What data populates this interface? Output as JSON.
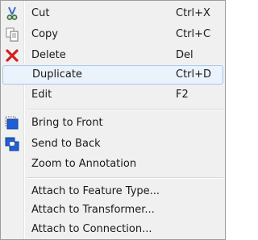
{
  "menu": {
    "items": [
      {
        "label": "Cut",
        "shortcut": "Ctrl+X",
        "icon": "scissors-icon"
      },
      {
        "label": "Copy",
        "shortcut": "Ctrl+C",
        "icon": "copy-icon"
      },
      {
        "label": "Delete",
        "shortcut": "Del",
        "icon": "delete-x-icon"
      },
      {
        "label": "Duplicate",
        "shortcut": "Ctrl+D"
      },
      {
        "label": "Edit",
        "shortcut": "F2"
      },
      {
        "label": "Bring to Front",
        "icon": "bring-to-front-icon"
      },
      {
        "label": "Send to Back",
        "icon": "send-to-back-icon"
      },
      {
        "label": "Zoom to Annotation"
      },
      {
        "label": "Attach to Feature Type..."
      },
      {
        "label": "Attach to Transformer..."
      },
      {
        "label": "Attach to Connection..."
      }
    ],
    "highlighted_item": "Duplicate",
    "colors": {
      "highlight_bg": "#eaf2fb",
      "highlight_border": "#a8c8ec",
      "icon_blue": "#1f5fd6",
      "delete_red": "#d42020"
    }
  }
}
